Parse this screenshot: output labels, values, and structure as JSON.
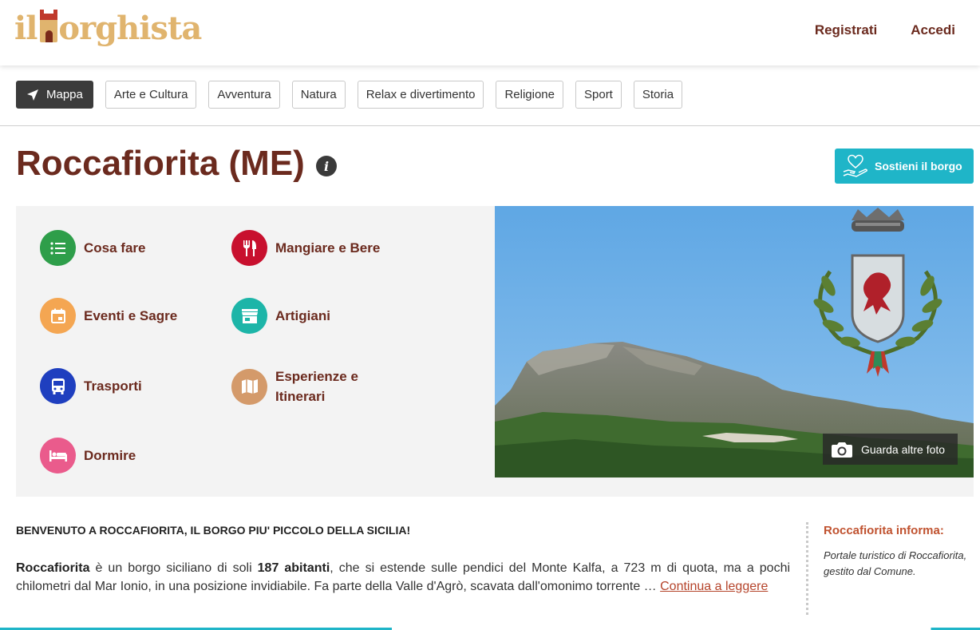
{
  "header": {
    "logo_pre": "il ",
    "logo_post": "orghista",
    "register": "Registrati",
    "login": "Accedi"
  },
  "categories": [
    {
      "label": "Mappa",
      "icon": "navigation-arrow-icon"
    },
    {
      "label": "Arte e Cultura"
    },
    {
      "label": "Avventura"
    },
    {
      "label": "Natura"
    },
    {
      "label": "Relax e divertimento"
    },
    {
      "label": "Religione"
    },
    {
      "label": "Sport"
    },
    {
      "label": "Storia"
    }
  ],
  "title": "Roccafiorita (ME)",
  "info_icon_glyph": "i",
  "support_button": "Sostieni il borgo",
  "services": [
    {
      "label": "Cosa fare",
      "icon": "list-icon",
      "color": "#2e9e4a"
    },
    {
      "label": "Mangiare e Bere",
      "icon": "fork-knife-icon",
      "color": "#c8102e"
    },
    {
      "label": "Eventi e Sagre",
      "icon": "calendar-icon",
      "color": "#f4a652"
    },
    {
      "label": "Artigiani",
      "icon": "shop-icon",
      "color": "#1db5a8"
    },
    {
      "label": "Trasporti",
      "icon": "bus-icon",
      "color": "#1f3fbf"
    },
    {
      "label_line1": "Esperienze e",
      "label_line2": "Itinerari",
      "icon": "map-icon",
      "color": "#d49a6a"
    },
    {
      "label": "Dormire",
      "icon": "bed-icon",
      "color": "#ea5b8c"
    }
  ],
  "photo_button": "Guarda altre foto",
  "intro": {
    "heading": "BENVENUTO A ROCCAFIORITA, IL BORGO PIU' PICCOLO DELLA SICILIA!",
    "name": "Roccafiorita",
    "text1": " è un borgo siciliano di soli ",
    "inhabitants": "187 abitanti",
    "text2": ", che si estende sulle pendici del Monte Kalfa, a 723 m di quota, ma a pochi chilometri dal Mar Ionio, in una posizione invidiabile. Fa parte della Valle d'Agrò, scavata dall'omonimo torrente … ",
    "read_more": "Continua a leggere"
  },
  "sidebar": {
    "heading": "Roccafiorita informa:",
    "text": "Portale turistico di Roccafiorita, gestito dal Comune."
  },
  "colors": {
    "brand": "#e0b46e",
    "title": "#6b2a1e",
    "accent": "#1fb5c8"
  }
}
